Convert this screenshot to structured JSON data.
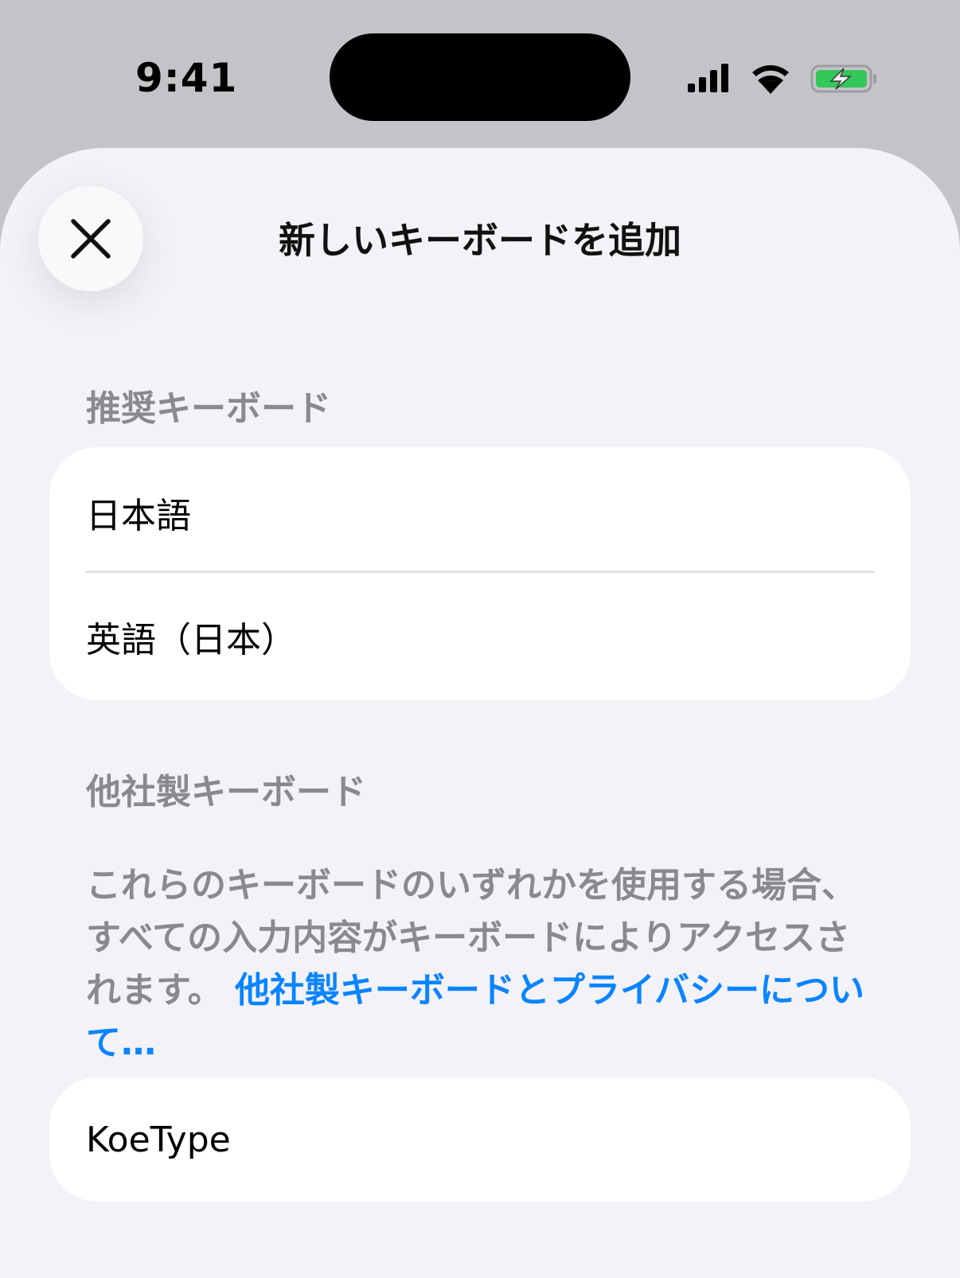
{
  "status_bar": {
    "time": "9:41"
  },
  "sheet": {
    "title": "新しいキーボードを追加",
    "close_icon": "close-icon"
  },
  "recommended": {
    "header": "推奨キーボード",
    "items": [
      {
        "label": "日本語"
      },
      {
        "label": "英語（日本）"
      }
    ]
  },
  "third_party": {
    "header": "他社製キーボード",
    "note": "これらのキーボードのいずれかを使用する場合、すべての入力内容がキーボードによりアクセスされます。",
    "link": "他社製キーボードとプライバシーについて…",
    "items": [
      {
        "label": "KoeType"
      }
    ]
  },
  "colors": {
    "link": "#0a84ff",
    "battery_charging": "#34c759",
    "sheet_background": "#f2f2f7",
    "secondary_text": "#8a8a8e"
  },
  "icons": [
    "cellular-signal-icon",
    "wifi-icon",
    "battery-charging-icon",
    "close-icon"
  ]
}
